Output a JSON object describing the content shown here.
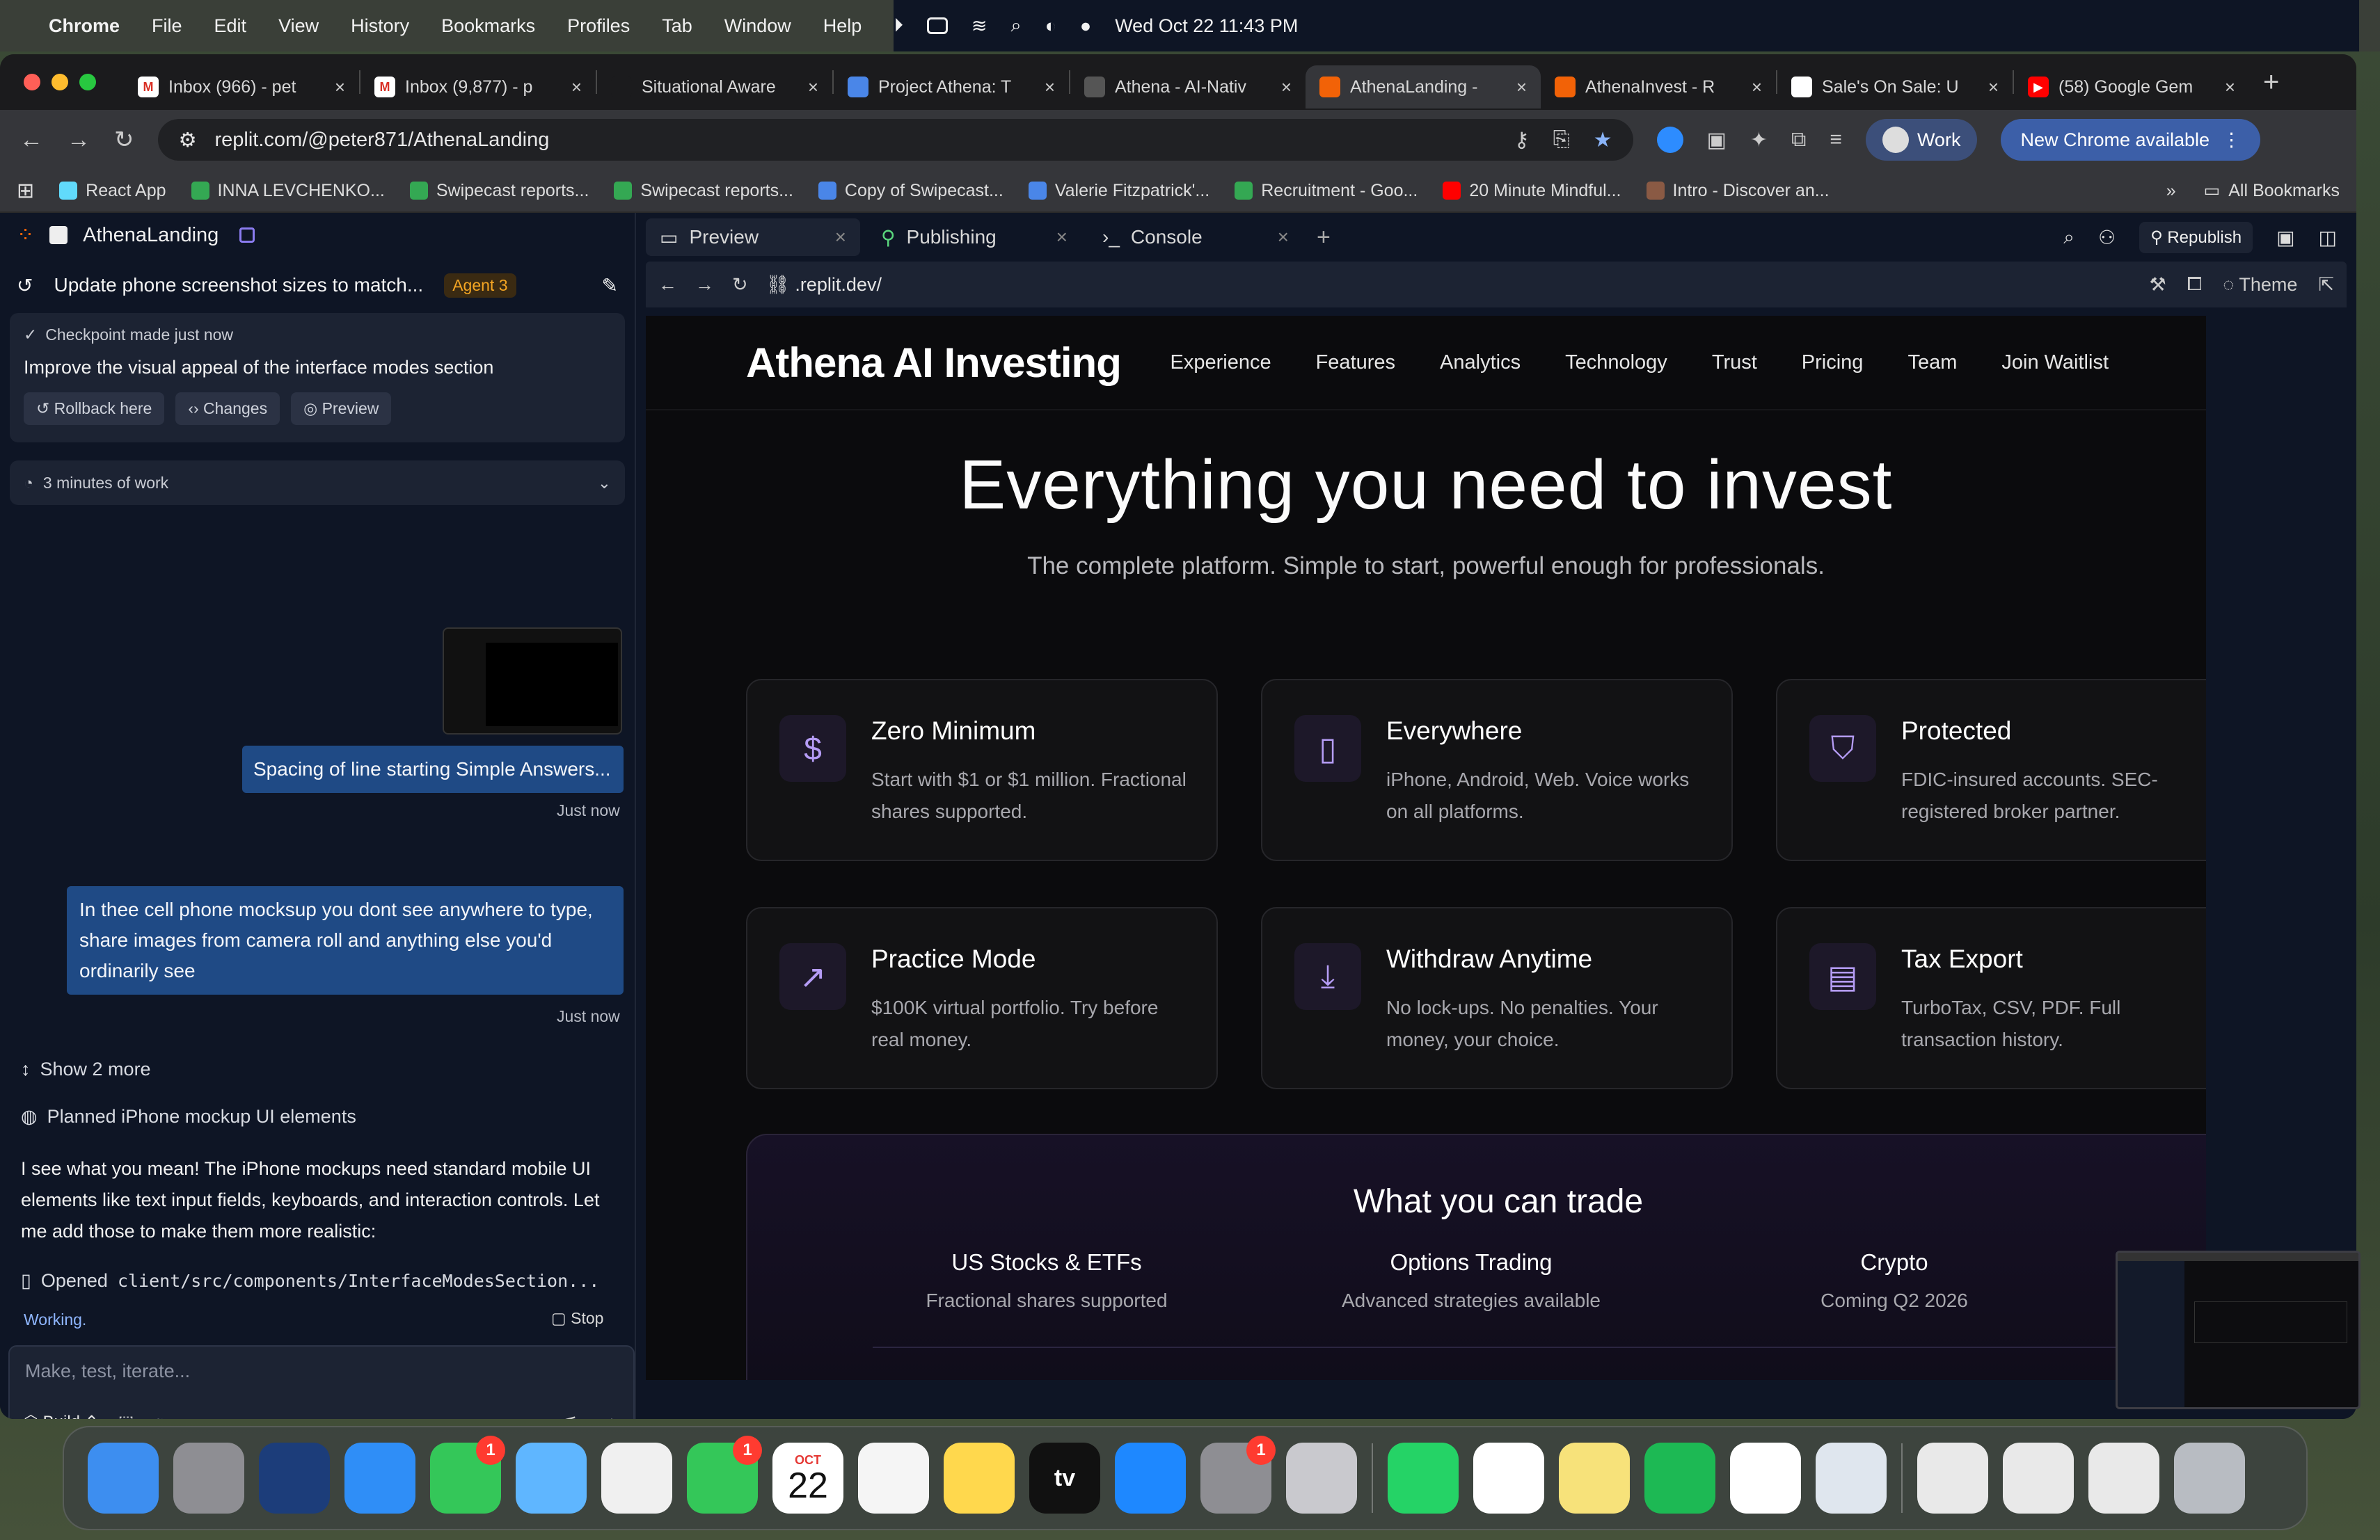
{
  "menubar": {
    "app": "Chrome",
    "items": [
      "File",
      "Edit",
      "View",
      "History",
      "Bookmarks",
      "Profiles",
      "Tab",
      "Window",
      "Help"
    ],
    "datetime": "Wed Oct 22  11:43 PM"
  },
  "tabs": [
    {
      "title": "Inbox (966) - pet",
      "fav": "gmail-icon",
      "color": "#ffffff",
      "glyph": "M"
    },
    {
      "title": "Inbox (9,877) - p",
      "fav": "gmail-icon",
      "color": "#ffffff",
      "glyph": "M"
    },
    {
      "title": "Situational Aware",
      "fav": "document-icon",
      "color": "#1b1b1d",
      "glyph": ""
    },
    {
      "title": "Project Athena: T",
      "fav": "google-docs-icon",
      "color": "#4a86e8",
      "glyph": ""
    },
    {
      "title": "Athena - AI-Nativ",
      "fav": "globe-icon",
      "color": "#555555",
      "glyph": ""
    },
    {
      "title": "AthenaLanding -",
      "fav": "replit-icon",
      "color": "#f26207",
      "glyph": "",
      "active": true
    },
    {
      "title": "AthenaInvest - R",
      "fav": "replit-icon",
      "color": "#f26207",
      "glyph": ""
    },
    {
      "title": "Sale's On Sale: U",
      "fav": "site-icon",
      "color": "#ffffff",
      "glyph": ""
    },
    {
      "title": "(58) Google Gem",
      "fav": "youtube-icon",
      "color": "#ff0000",
      "glyph": "▶"
    }
  ],
  "toolbar": {
    "url": "replit.com/@peter871/AthenaLanding",
    "work_label": "Work",
    "new_chrome": "New Chrome available"
  },
  "bookmarks": [
    {
      "label": "React App",
      "color": "#61dafb"
    },
    {
      "label": "INNA LEVCHENKO...",
      "color": "#34a853"
    },
    {
      "label": "Swipecast reports...",
      "color": "#34a853"
    },
    {
      "label": "Swipecast reports...",
      "color": "#34a853"
    },
    {
      "label": "Copy of Swipecast...",
      "color": "#4a86e8"
    },
    {
      "label": "Valerie Fitzpatrick'...",
      "color": "#4a86e8"
    },
    {
      "label": "Recruitment - Goo...",
      "color": "#34a853"
    },
    {
      "label": "20 Minute Mindful...",
      "color": "#ff0000"
    },
    {
      "label": "Intro - Discover an...",
      "color": "#8a5a44"
    }
  ],
  "bookmarks_all": "All Bookmarks",
  "replit": {
    "project": "AthenaLanding",
    "thread_title": "Update phone screenshot sizes to match...",
    "agent_badge": "Agent 3",
    "checkpoint": {
      "label": "Checkpoint made just now",
      "message": "Improve the visual appeal of the interface modes section",
      "buttons": [
        "Rollback here",
        "Changes",
        "Preview"
      ]
    },
    "work_time": "3 minutes of work",
    "msg1": "Spacing of line starting Simple Answers...",
    "msg1_time": "Just now",
    "msg2": "In thee cell phone mocksup you dont see anywhere to type, share images from camera roll and anything else you'd ordinarily see",
    "msg2_time": "Just now",
    "show_more": "Show 2 more",
    "planned": "Planned iPhone mockup UI elements",
    "assistant": "I see what you mean! The iPhone mockups need standard mobile UI elements like text input fields, keyboards, and interaction controls. Let me add those to make them more realistic:",
    "opened_prefix": "Opened",
    "opened_file": "client/src/components/InterfaceModesSection...",
    "status": "Working.",
    "stop": "Stop",
    "input_placeholder": "Make, test, iterate...",
    "build": "Build"
  },
  "panel": {
    "tabs": [
      "Preview",
      "Publishing",
      "Console"
    ],
    "republish": "Republish",
    "url": ".replit.dev/",
    "theme": "Theme"
  },
  "site": {
    "logo": "Athena AI Investing",
    "nav": [
      "Experience",
      "Features",
      "Analytics",
      "Technology",
      "Trust",
      "Pricing",
      "Team",
      "Join Waitlist"
    ],
    "hero_title": "Everything you need to invest",
    "hero_sub": "The complete platform. Simple to start, powerful enough for professionals.",
    "features": [
      {
        "title": "Zero Minimum",
        "desc": "Start with $1 or $1 million. Fractional shares supported.",
        "icon": "dollar-icon",
        "glyph": "$"
      },
      {
        "title": "Everywhere",
        "desc": "iPhone, Android, Web. Voice works on all platforms.",
        "icon": "phone-icon",
        "glyph": "▯"
      },
      {
        "title": "Protected",
        "desc": "FDIC-insured accounts. SEC-registered broker partner.",
        "icon": "shield-icon",
        "glyph": "⛉"
      },
      {
        "title": "Practice Mode",
        "desc": "$100K virtual portfolio. Try before real money.",
        "icon": "trending-up-icon",
        "glyph": "↗"
      },
      {
        "title": "Withdraw Anytime",
        "desc": "No lock-ups. No penalties. Your money, your choice.",
        "icon": "download-icon",
        "glyph": "⤓"
      },
      {
        "title": "Tax Export",
        "desc": "TurboTax, CSV, PDF. Full transaction history.",
        "icon": "file-icon",
        "glyph": "▤"
      }
    ],
    "trade_title": "What you can trade",
    "trade": [
      {
        "title": "US Stocks & ETFs",
        "desc": "Fractional shares supported"
      },
      {
        "title": "Options Trading",
        "desc": "Advanced strategies available"
      },
      {
        "title": "Crypto",
        "desc": "Coming Q2 2026"
      }
    ]
  },
  "dock": [
    {
      "name": "finder-icon",
      "color": "#3d8ef0"
    },
    {
      "name": "launchpad-icon",
      "color": "#8e8e93"
    },
    {
      "name": "spark-mail-icon",
      "color": "#1c3d7a"
    },
    {
      "name": "safari-icon",
      "color": "#2f8ef7"
    },
    {
      "name": "messages-icon",
      "color": "#34c759",
      "badge": "1"
    },
    {
      "name": "maps-icon",
      "color": "#5fb6ff"
    },
    {
      "name": "photos-icon",
      "color": "#f0f0f0"
    },
    {
      "name": "facetime-icon",
      "color": "#34c759",
      "badge": "1"
    },
    {
      "name": "calendar-icon",
      "color": "#ffffff",
      "month": "OCT",
      "day": "22"
    },
    {
      "name": "reminders-icon",
      "color": "#f5f5f5"
    },
    {
      "name": "notes-icon",
      "color": "#ffd84d"
    },
    {
      "name": "apple-tv-icon",
      "color": "#111111",
      "text": "tv"
    },
    {
      "name": "app-store-icon",
      "color": "#1e88ff"
    },
    {
      "name": "system-settings-icon",
      "color": "#8e8e93",
      "badge": "1"
    },
    {
      "name": "iphone-mirroring-icon",
      "color": "#c9c9ce"
    },
    {
      "sep": true
    },
    {
      "name": "whatsapp-icon",
      "color": "#25d366"
    },
    {
      "name": "slack-icon",
      "color": "#ffffff"
    },
    {
      "name": "stickies-icon",
      "color": "#f7e27a"
    },
    {
      "name": "spotify-icon",
      "color": "#1db954"
    },
    {
      "name": "chrome-icon",
      "color": "#ffffff"
    },
    {
      "name": "preview-icon",
      "color": "#dfe6ee"
    },
    {
      "sep": true
    },
    {
      "name": "document-stack-icon",
      "color": "#e9e9e9"
    },
    {
      "name": "window-stack-icon",
      "color": "#e9e9e9"
    },
    {
      "name": "window-stack-icon-2",
      "color": "#e9e9e9"
    },
    {
      "name": "trash-icon",
      "color": "#b8bcc2"
    }
  ]
}
